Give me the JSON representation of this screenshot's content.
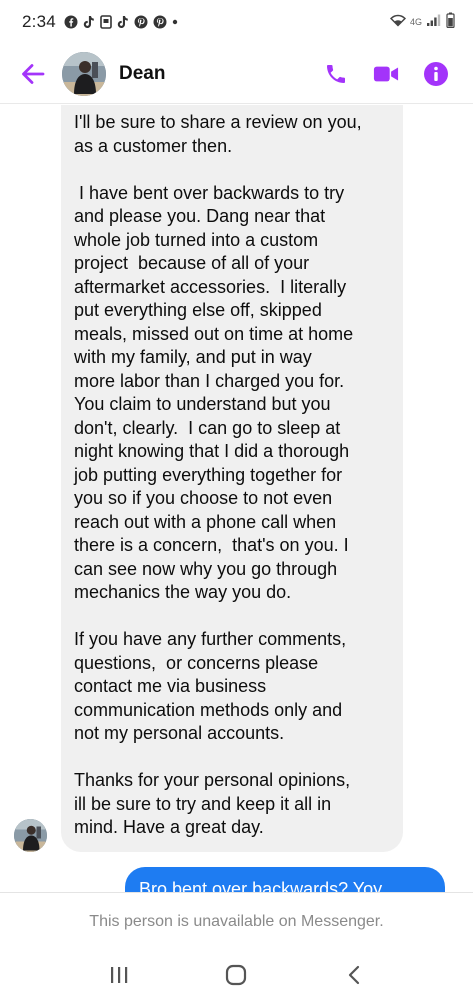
{
  "status_bar": {
    "time": "2:34",
    "network": "4G",
    "app_icons": [
      "facebook-icon",
      "tiktok-icon",
      "screenshot-icon",
      "tiktok-icon",
      "pinterest-icon",
      "pinterest-icon",
      "dot-icon"
    ]
  },
  "header": {
    "contact_name": "Dean",
    "accent_color": "#a334fa"
  },
  "messages": {
    "incoming": {
      "paragraphs": [
        "I'll be sure to share a review on you,\nas a customer then.",
        " I have bent over backwards to try\nand please you. Dang near that\nwhole job turned into a custom\nproject  because of all of your\naftermarket accessories.  I literally\nput everything else off, skipped\nmeals, missed out on time at home\nwith my family, and put in way\nmore labor than I charged you for.\nYou claim to understand but you\ndon't, clearly.  I can go to sleep at\nnight knowing that I did a thorough\njob putting everything together for\nyou so if you choose to not even\nreach out with a phone call when\nthere is a concern,  that's on you. I\ncan see now why you go through\nmechanics the way you do.",
        "If you have any further comments,\nquestions,  or concerns please\ncontact me via business\ncommunication methods only and\nnot my personal accounts.",
        "Thanks for your personal opinions,\nill be sure to try and keep it all in\nmind. Have a great day."
      ],
      "bubble_color": "#f0f0f0"
    },
    "outgoing": {
      "text": "Bro bent over backwards? Yoy",
      "bubble_color": "#1e7cf2"
    }
  },
  "footer": {
    "unavailable_text": "This person is unavailable on Messenger."
  }
}
